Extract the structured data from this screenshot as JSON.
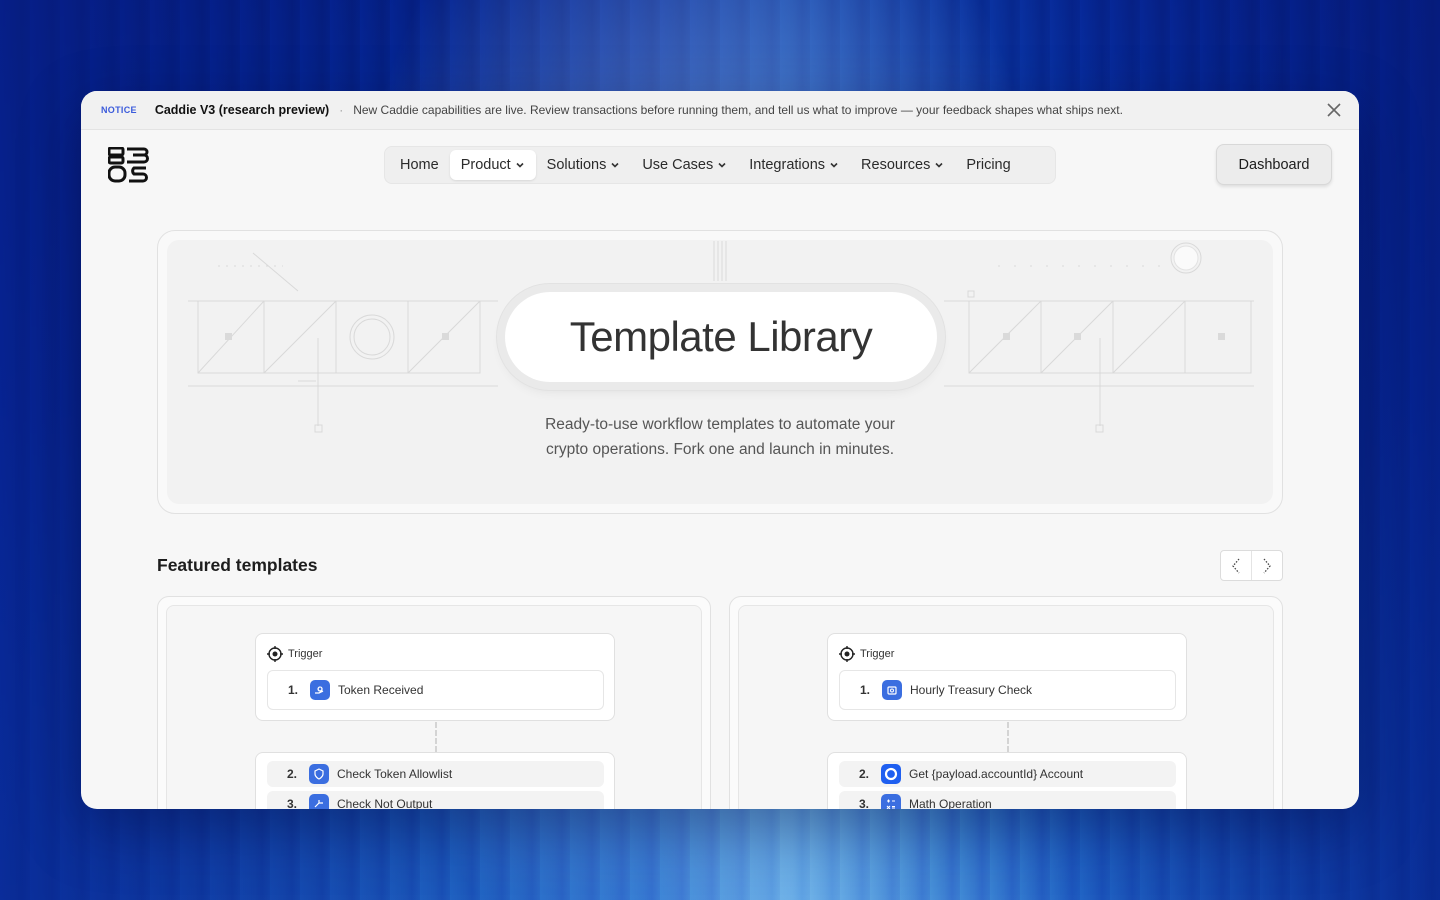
{
  "notice": {
    "badge": "NOTICE",
    "title": "Caddie V3 (research preview)",
    "separator": "·",
    "text": "New Caddie capabilities are live. Review transactions before running them, and tell us what to improve — your feedback shapes what ships next."
  },
  "nav": {
    "items": [
      {
        "label": "Home",
        "dropdown": false
      },
      {
        "label": "Product",
        "dropdown": true,
        "active": true
      },
      {
        "label": "Solutions",
        "dropdown": true
      },
      {
        "label": "Use Cases",
        "dropdown": true
      },
      {
        "label": "Integrations",
        "dropdown": true
      },
      {
        "label": "Resources",
        "dropdown": true
      },
      {
        "label": "Pricing",
        "dropdown": false
      }
    ],
    "dashboard_label": "Dashboard"
  },
  "hero": {
    "title": "Template Library",
    "subtitle_line1": "Ready-to-use workflow templates to automate your",
    "subtitle_line2": "crypto operations. Fork one and launch in minutes."
  },
  "featured": {
    "title": "Featured templates",
    "cards": [
      {
        "trigger_label": "Trigger",
        "trigger_step": {
          "num": "1.",
          "label": "Token Received",
          "icon": "hand-coin-icon"
        },
        "steps": [
          {
            "num": "2.",
            "label": "Check Token Allowlist",
            "icon": "shield-check-icon"
          },
          {
            "num": "3.",
            "label": "Check Not Output",
            "icon": "flow-icon"
          }
        ]
      },
      {
        "trigger_label": "Trigger",
        "trigger_step": {
          "num": "1.",
          "label": "Hourly Treasury Check",
          "icon": "calendar-icon"
        },
        "steps": [
          {
            "num": "2.",
            "label": "Get {payload.accountId} Account",
            "icon": "circle-logo-icon"
          },
          {
            "num": "3.",
            "label": "Math Operation",
            "icon": "calculator-icon"
          }
        ]
      }
    ]
  },
  "colors": {
    "accent": "#3b6ee0",
    "notice_badge": "#3b5bdb"
  }
}
